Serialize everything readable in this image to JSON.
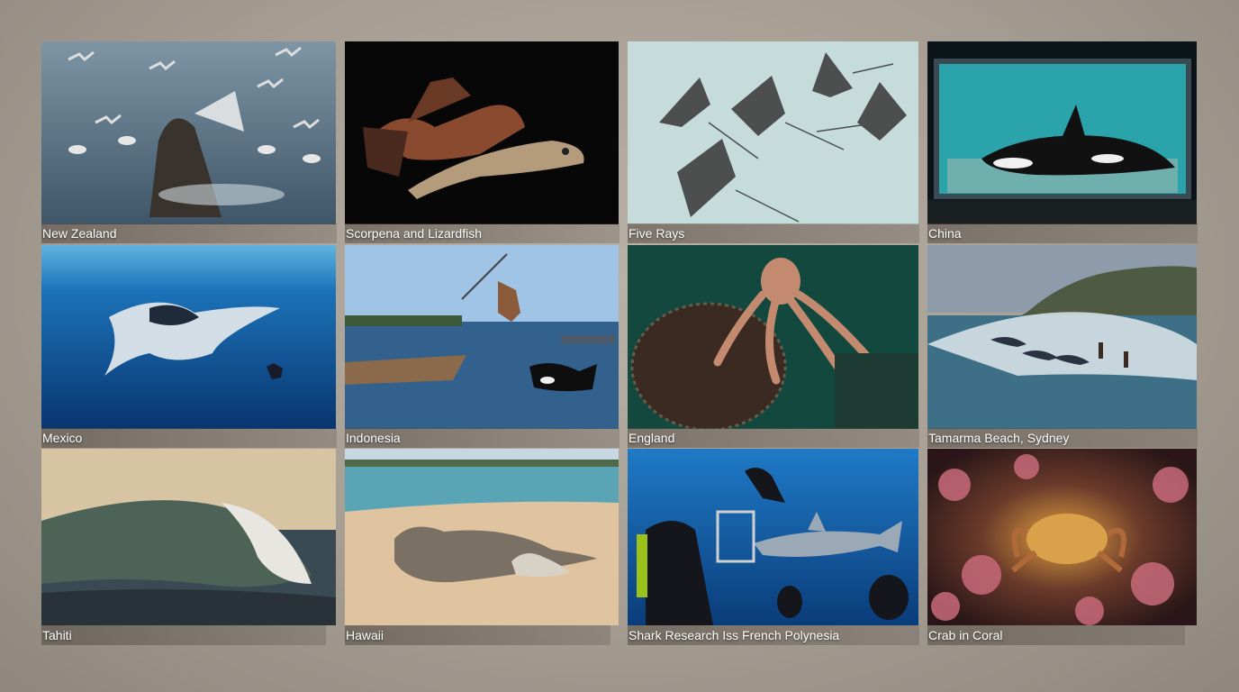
{
  "gallery": {
    "tiles": [
      {
        "caption": "New Zealand",
        "image": "sea-lion-and-gannets-photo"
      },
      {
        "caption": "Scorpena and Lizardfish",
        "image": "scorpionfish-photo"
      },
      {
        "caption": "Five Rays",
        "image": "eagle-rays-photo"
      },
      {
        "caption": "China",
        "image": "orca-aquarium-photo"
      },
      {
        "caption": "Mexico",
        "image": "manta-ray-diver-photo"
      },
      {
        "caption": "Indonesia",
        "image": "spear-fisher-orca-photo"
      },
      {
        "caption": "England",
        "image": "octopus-lobster-pot-photo"
      },
      {
        "caption": "Tamarma Beach, Sydney",
        "image": "dolphins-surfers-photo"
      },
      {
        "caption": "Tahiti",
        "image": "breaking-wave-photo"
      },
      {
        "caption": "Hawaii",
        "image": "monk-seals-beach-photo"
      },
      {
        "caption": "Shark Research Iss French Polynesia",
        "image": "shark-research-divers-photo"
      },
      {
        "caption": "Crab in Coral",
        "image": "crab-coral-photo"
      }
    ]
  }
}
